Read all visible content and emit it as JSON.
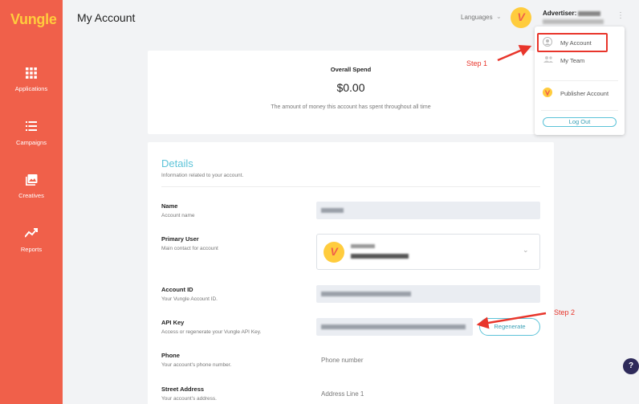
{
  "brand": {
    "logo_text": "Vungle",
    "sidebar_color": "#f0604a",
    "logo_color": "#ffcc3d",
    "accent": "#5cc3d8"
  },
  "sidebar": {
    "items": [
      {
        "label": "Applications",
        "icon": "grid-icon"
      },
      {
        "label": "Campaigns",
        "icon": "list-icon"
      },
      {
        "label": "Creatives",
        "icon": "image-icon"
      },
      {
        "label": "Reports",
        "icon": "trend-icon"
      }
    ]
  },
  "header": {
    "title": "My Account",
    "languages_label": "Languages",
    "advertiser_label": "Advertiser:"
  },
  "dropdown": {
    "items": [
      {
        "label": "My Account",
        "icon": "user-icon"
      },
      {
        "label": "My Team",
        "icon": "team-icon"
      },
      {
        "label": "Publisher Account",
        "icon": "vungle-v-icon"
      }
    ],
    "logout_label": "Log Out"
  },
  "spend": {
    "title": "Overall Spend",
    "value": "$0.00",
    "description": "The amount of money this account has spent throughout all time"
  },
  "details": {
    "title": "Details",
    "subtitle": "Information related to your account.",
    "fields": {
      "name": {
        "label": "Name",
        "desc": "Account name"
      },
      "primary_user": {
        "label": "Primary User",
        "desc": "Main contact for account"
      },
      "account_id": {
        "label": "Account ID",
        "desc": "Your Vungle Account ID."
      },
      "api_key": {
        "label": "API Key",
        "desc": "Access or regenerate your Vungle API Key.",
        "button": "Regenerate"
      },
      "phone": {
        "label": "Phone",
        "desc": "Your account's phone number.",
        "placeholder": "Phone number"
      },
      "street": {
        "label": "Street Address",
        "desc": "Your account's address.",
        "placeholder": "Address Line 1"
      }
    }
  },
  "annotations": {
    "step1": "Step 1",
    "step2": "Step 2",
    "color": "#e8352b"
  }
}
